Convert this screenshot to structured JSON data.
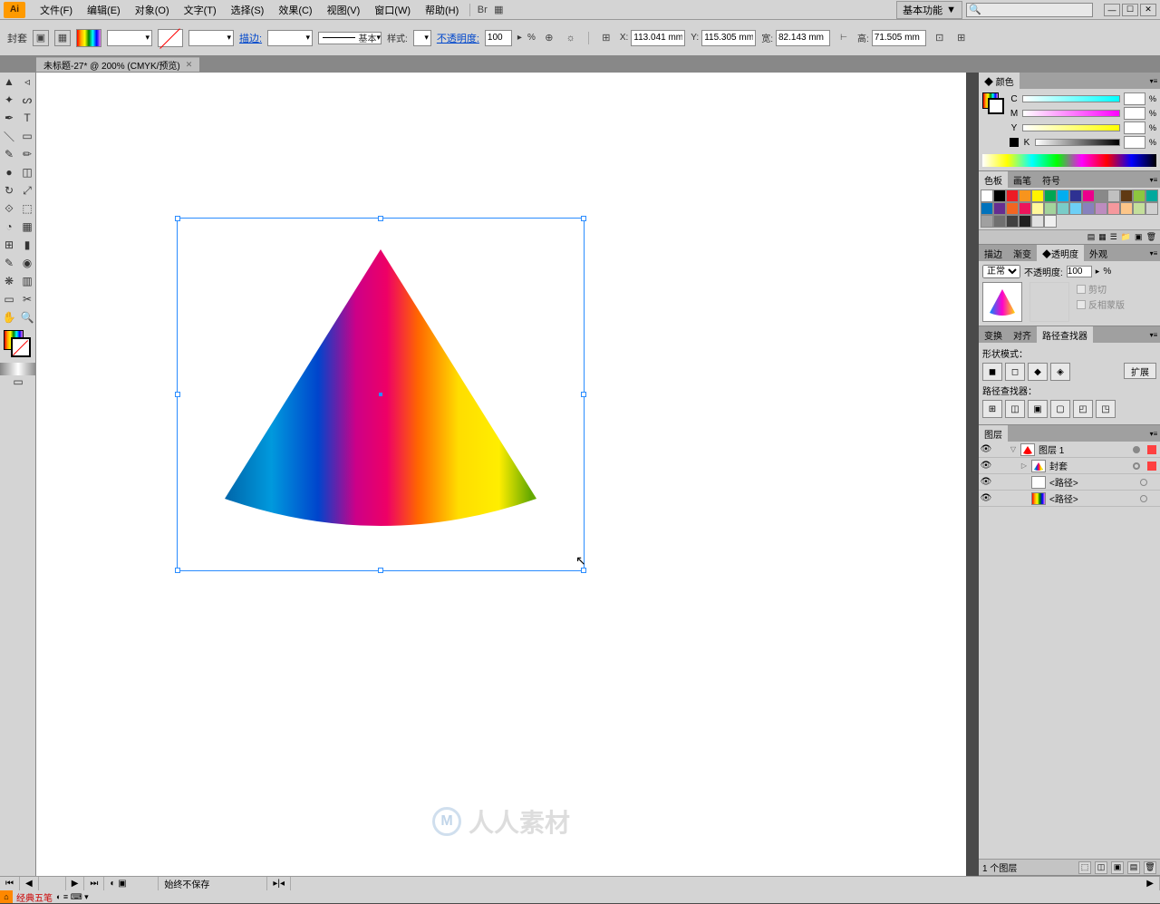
{
  "app": {
    "logo": "Ai"
  },
  "menu": {
    "file": "文件(F)",
    "edit": "编辑(E)",
    "object": "对象(O)",
    "type": "文字(T)",
    "select": "选择(S)",
    "effect": "效果(C)",
    "view": "视图(V)",
    "window": "窗口(W)",
    "help": "帮助(H)"
  },
  "workspace": {
    "label": "基本功能"
  },
  "controlbar": {
    "object_label": "封套",
    "stroke_label": "描边:",
    "stroke_weight": "",
    "stroke_style_label": "基本",
    "style_label": "样式:",
    "opacity_label": "不透明度:",
    "opacity_value": "100",
    "opacity_pct": "%",
    "x_label": "X:",
    "x_value": "113.041 mm",
    "y_label": "Y:",
    "y_value": "115.305 mm",
    "w_label": "宽:",
    "w_value": "82.143 mm",
    "h_label": "高:",
    "h_value": "71.505 mm"
  },
  "document": {
    "tab_title": "未标题-27* @ 200% (CMYK/预览)"
  },
  "panels": {
    "color": {
      "title": "颜色",
      "channels": [
        "C",
        "M",
        "Y",
        "K"
      ],
      "pct": "%"
    },
    "swatches": {
      "tabs": [
        "色板",
        "画笔",
        "符号"
      ]
    },
    "transparency": {
      "tabs": [
        "描边",
        "渐变",
        "透明度",
        "外观"
      ],
      "blend": "正常",
      "opacity_label": "不透明度:",
      "opacity_value": "100",
      "opt_clip": "剪切",
      "opt_invert": "反相蒙版"
    },
    "pathfinder": {
      "tabs": [
        "变换",
        "对齐",
        "路径查找器"
      ],
      "shape_modes": "形状模式：",
      "expand": "扩展",
      "pathfinders": "路径查找器："
    },
    "layers": {
      "title": "图层",
      "items": [
        {
          "name": "图层 1",
          "indent": 0,
          "expanded": true,
          "selected": true,
          "color": "#ff4040"
        },
        {
          "name": "封套",
          "indent": 1,
          "expanded": false
        },
        {
          "name": "<路径>",
          "indent": 2,
          "expanded": false,
          "white": true
        },
        {
          "name": "<路径>",
          "indent": 2,
          "expanded": false
        }
      ],
      "footer_text": "1 个图层"
    }
  },
  "status": {
    "autosave": "始终不保存"
  },
  "ime": {
    "label": "经典五笔"
  },
  "watermark": {
    "text": "人人素材"
  }
}
